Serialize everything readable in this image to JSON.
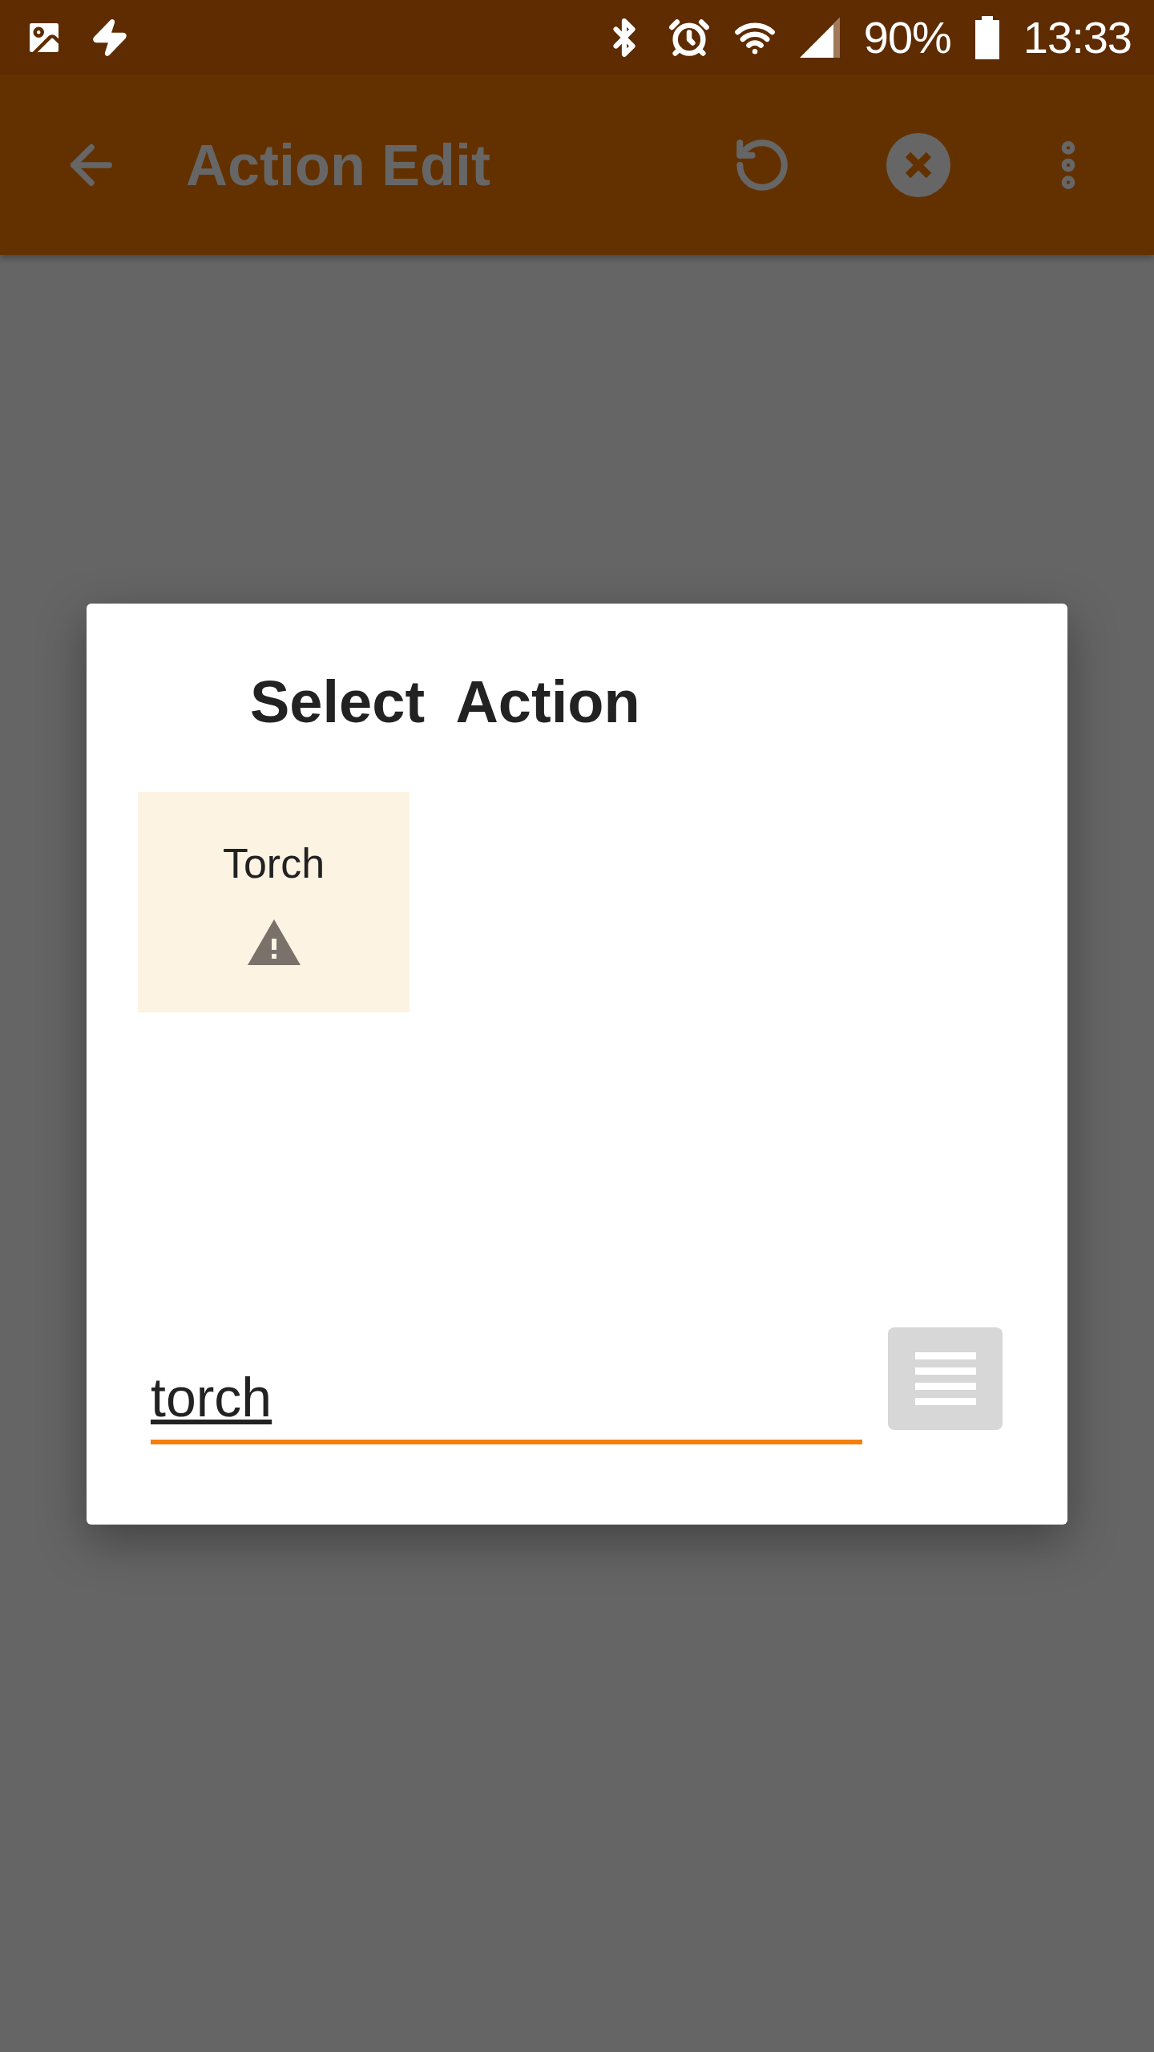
{
  "status_bar": {
    "battery": "90%",
    "time": "13:33"
  },
  "app_bar": {
    "title": "Action Edit"
  },
  "dialog": {
    "title": "Select  Action",
    "actions": [
      {
        "label": "Torch",
        "warning": true
      }
    ],
    "search": {
      "value": "torch"
    }
  }
}
